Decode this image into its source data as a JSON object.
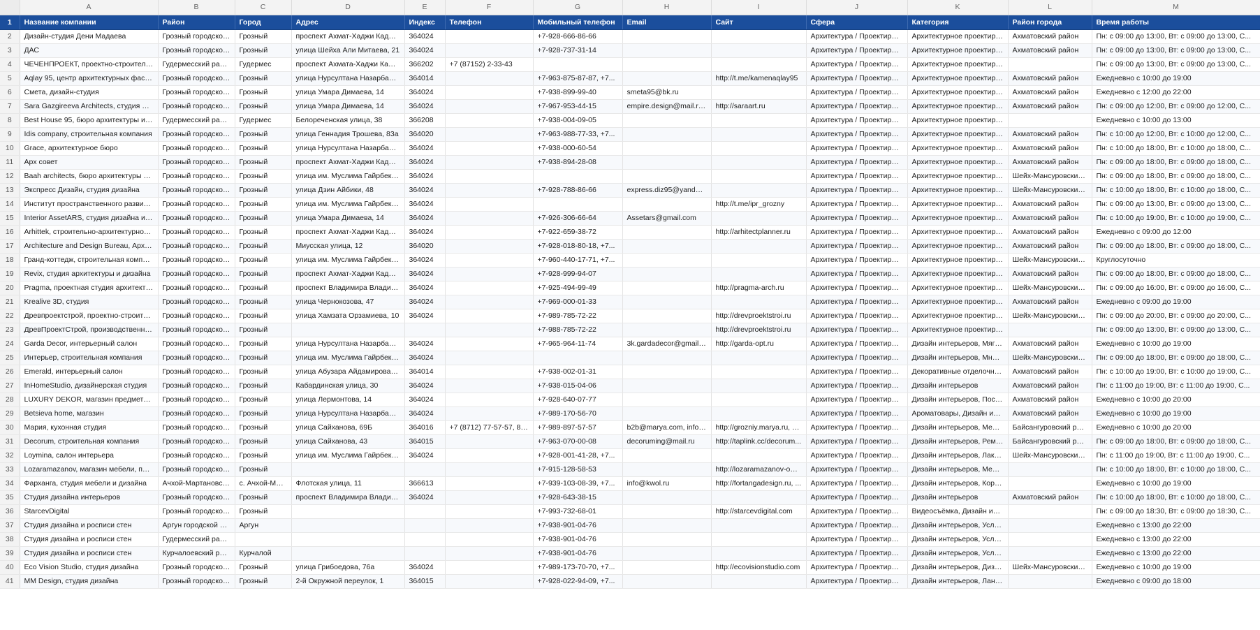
{
  "columns": [
    "A",
    "B",
    "C",
    "D",
    "E",
    "F",
    "G",
    "H",
    "I",
    "J",
    "K",
    "L",
    "M"
  ],
  "headers": [
    "Название компании",
    "Район",
    "Город",
    "Адрес",
    "Индекс",
    "Телефон",
    "Мобильный телефон",
    "Email",
    "Сайт",
    "Сфера",
    "Категория",
    "Район города",
    "Время работы"
  ],
  "rows": [
    [
      "Дизайн-студия Дени Мадаева",
      "Грозный городской ок...",
      "Грозный",
      "проспект Ахмат-Хаджи Кадыр...",
      "364024",
      "",
      "+7-928-666-86-66",
      "",
      "",
      "Архитектура / Проектиров...",
      "Архитектурное проектиро...",
      "Ахматовский район",
      "Пн: с 09:00 до 13:00, Вт: с 09:00 до 13:00, С..."
    ],
    [
      "ДАС",
      "Грозный городской ок...",
      "Грозный",
      "улица Шейха Али Митаева, 21",
      "364024",
      "",
      "+7-928-737-31-14",
      "",
      "",
      "Архитектура / Проектиров...",
      "Архитектурное проектиро...",
      "Ахматовский район",
      "Пн: с 09:00 до 13:00, Вт: с 09:00 до 13:00, С..."
    ],
    [
      "ЧЕЧЕНПРОЕКТ, проектно-строительн...",
      "Гудермесский район",
      "Гудермес",
      "проспект Ахмата-Хаджи Кады...",
      "366202",
      "+7 (87152) 2-33-43",
      "",
      "",
      "",
      "Архитектура / Проектиров...",
      "Архитектурное проектиро...",
      "",
      "Пн: с 09:00 до 13:00, Вт: с 09:00 до 13:00, С..."
    ],
    [
      "Aqlay 95, центр архитектурных фасад...",
      "Грозный городской ок...",
      "Грозный",
      "улица Нурсултана Назарбаева...",
      "364014",
      "",
      "+7-963-875-87-87, +7...",
      "",
      "http://t.me/kamenaqlay95",
      "Архитектура / Проектиров...",
      "Архитектурное проектиро...",
      "Ахматовский район",
      "Ежедневно с 10:00 до 19:00"
    ],
    [
      "Смета, дизайн-студия",
      "Грозный городской ок...",
      "Грозный",
      "улица Умара Димаева, 14",
      "364024",
      "",
      "+7-938-899-99-40",
      "smeta95@bk.ru",
      "",
      "Архитектура / Проектиров...",
      "Архитектурное проектиро...",
      "Ахматовский район",
      "Ежедневно с 12:00 до 22:00"
    ],
    [
      "Sara Gazgireeva Architects, студия арх...",
      "Грозный городской ок...",
      "Грозный",
      "улица Умара Димаева, 14",
      "364024",
      "",
      "+7-967-953-44-15",
      "empire.design@mail.ru, ...",
      "http://saraart.ru",
      "Архитектура / Проектиров...",
      "Архитектурное проектиро...",
      "Ахматовский район",
      "Пн: с 09:00 до 12:00, Вт: с 09:00 до 12:00, С..."
    ],
    [
      "Best House 95, бюро архитектуры и д...",
      "Гудермесский район",
      "Гудермес",
      "Белореченская улица, 38",
      "366208",
      "",
      "+7-938-004-09-05",
      "",
      "",
      "Архитектура / Проектиров...",
      "Архитектурное проектиро...",
      "",
      "Ежедневно с 10:00 до 13:00"
    ],
    [
      "Idis company, строительная компания",
      "Грозный городской ок...",
      "Грозный",
      "улица Геннадия Трошева, 83а",
      "364020",
      "",
      "+7-963-988-77-33, +7...",
      "",
      "",
      "Архитектура / Проектиров...",
      "Архитектурное проектиро...",
      "Ахматовский район",
      "Пн: с 10:00 до 12:00, Вт: с 10:00 до 12:00, С..."
    ],
    [
      "Grace, архитектурное бюро",
      "Грозный городской ок...",
      "Грозный",
      "улица Нурсултана Назарбаева...",
      "364024",
      "",
      "+7-938-000-60-54",
      "",
      "",
      "Архитектура / Проектиров...",
      "Архитектурное проектиро...",
      "Ахматовский район",
      "Пн: с 10:00 до 18:00, Вт: с 10:00 до 18:00, С..."
    ],
    [
      "Apx совет",
      "Грозный городской ок...",
      "Грозный",
      "проспект Ахмат-Хаджи Кадыр...",
      "364024",
      "",
      "+7-938-894-28-08",
      "",
      "",
      "Архитектура / Проектиров...",
      "Архитектурное проектиро...",
      "Ахматовский район",
      "Пн: с 09:00 до 18:00, Вт: с 09:00 до 18:00, С..."
    ],
    [
      "Baah architects, бюро архитектуры и д...",
      "Грозный городской ок...",
      "Грозный",
      "улица им. Муслима Гайрбеков...",
      "364024",
      "",
      "",
      "",
      "",
      "Архитектура / Проектиров...",
      "Архитектурное проектиро...",
      "Шейх-Мансуровский...",
      "Пн: с 09:00 до 18:00, Вт: с 09:00 до 18:00, С..."
    ],
    [
      "Экспресс Дизайн, студия дизайна",
      "Грозный городской ок...",
      "Грозный",
      "улица Дзин Айбики, 48",
      "364024",
      "",
      "+7-928-788-86-66",
      "express.diz95@yandex.ru",
      "",
      "Архитектура / Проектиров...",
      "Архитектурное проектиро...",
      "Шейх-Мансуровский...",
      "Пн: с 10:00 до 18:00, Вт: с 10:00 до 18:00, С..."
    ],
    [
      "Институт пространственного развити...",
      "Грозный городской ок...",
      "Грозный",
      "улица им. Муслима Гайрбеков...",
      "364024",
      "",
      "",
      "",
      "http://t.me/ipr_grozny",
      "Архитектура / Проектиров...",
      "Архитектурное проектиро...",
      "Ахматовский район",
      "Пн: с 09:00 до 13:00, Вт: с 09:00 до 13:00, С..."
    ],
    [
      "Interior AssetARS, студия дизайна и ин...",
      "Грозный городской ок...",
      "Грозный",
      "улица Умара Димаева, 14",
      "364024",
      "",
      "+7-926-306-66-64",
      "Assetars@gmail.com",
      "",
      "Архитектура / Проектиров...",
      "Архитектурное проектиро...",
      "Ахматовский район",
      "Пн: с 10:00 до 19:00, Вт: с 10:00 до 19:00, С..."
    ],
    [
      "Arhittek, строительно-архитектурное ...",
      "Грозный городской ок...",
      "Грозный",
      "проспект Ахмат-Хаджи Кадыр...",
      "364024",
      "",
      "+7-922-659-38-72",
      "",
      "http://arhitectplanner.ru",
      "Архитектура / Проектиров...",
      "Архитектурное проектиро...",
      "Ахматовский район",
      "Ежедневно с 09:00 до 12:00"
    ],
    [
      "Architecture and Design Bureau, Архит...",
      "Грозный городской ок...",
      "Грозный",
      "Миусская улица, 12",
      "364020",
      "",
      "+7-928-018-80-18, +7...",
      "",
      "",
      "Архитектура / Проектиров...",
      "Архитектурное проектиро...",
      "Ахматовский район",
      "Пн: с 09:00 до 18:00, Вт: с 09:00 до 18:00, С..."
    ],
    [
      "Гранд-коттедж, строительная компан...",
      "Грозный городской ок...",
      "Грозный",
      "улица им. Муслима Гайрбеков...",
      "364024",
      "",
      "+7-960-440-17-71, +7...",
      "",
      "",
      "Архитектура / Проектиров...",
      "Архитектурное проектиро...",
      "Шейх-Мансуровский...",
      "Круглосуточно"
    ],
    [
      "Revix, студия архитектуры и дизайна",
      "Грозный городской ок...",
      "Грозный",
      "проспект Ахмат-Хаджи Кадыр...",
      "364024",
      "",
      "+7-928-999-94-07",
      "",
      "",
      "Архитектура / Проектиров...",
      "Архитектурное проектиро...",
      "Ахматовский район",
      "Пн: с 09:00 до 18:00, Вт: с 09:00 до 18:00, С..."
    ],
    [
      "Pragma, проектная студия архитектур...",
      "Грозный городской ок...",
      "Грозный",
      "проспект Владимира Владими...",
      "364024",
      "",
      "+7-925-494-99-49",
      "",
      "http://pragma-arch.ru",
      "Архитектура / Проектиров...",
      "Архитектурное проектиро...",
      "Шейх-Мансуровский...",
      "Пн: с 09:00 до 16:00, Вт: с 09:00 до 16:00, С..."
    ],
    [
      "Krealive 3D, студия",
      "Грозный городской ок...",
      "Грозный",
      "улица Чернокозова, 47",
      "364024",
      "",
      "+7-969-000-01-33",
      "",
      "",
      "Архитектура / Проектиров...",
      "Архитектурное проектиро...",
      "Ахматовский район",
      "Ежедневно с 09:00 до 19:00"
    ],
    [
      "Древпроектстрой, проектно-строител...",
      "Грозный городской ок...",
      "Грозный",
      "улица Хамзата Орзамиева, 10",
      "364024",
      "",
      "+7-989-785-72-22",
      "",
      "http://drevproektstroi.ru",
      "Архитектура / Проектиров...",
      "Архитектурное проектиро...",
      "Шейх-Мансуровский...",
      "Пн: с 09:00 до 20:00, Вт: с 09:00 до 20:00, С..."
    ],
    [
      "ДревПроектСтрой, производственно-...",
      "Грозный городской ок...",
      "Грозный",
      "",
      "",
      "",
      "+7-988-785-72-22",
      "",
      "http://drevproektstroi.ru",
      "Архитектура / Проектиров...",
      "Архитектурное проектиро...",
      "",
      "Пн: с 09:00 до 13:00, Вт: с 09:00 до 13:00, С..."
    ],
    [
      "Garda Decor, интерьерный салон",
      "Грозный городской ок...",
      "Грозный",
      "улица Нурсултана Назарбаева...",
      "364024",
      "",
      "+7-965-964-11-74",
      "3k.gardadecor@gmail.c...",
      "http://garda-opt.ru",
      "Архитектура / Проектиров...",
      "Дизайн интерьеров, Мягка...",
      "Ахматовский район",
      "Ежедневно с 10:00 до 19:00"
    ],
    [
      "Интерьер, строительная компания",
      "Грозный городской ок...",
      "Грозный",
      "улица им. Муслима Гайрбеков...",
      "364024",
      "",
      "",
      "",
      "",
      "Архитектура / Проектиров...",
      "Дизайн интерьеров, Мног...",
      "Шейх-Мансуровский...",
      "Пн: с 09:00 до 18:00, Вт: с 09:00 до 18:00, С..."
    ],
    [
      "Emerald, интерьерный салон",
      "Грозный городской ок...",
      "Грозный",
      "улица Абузара Айдамирова, 1...",
      "364014",
      "",
      "+7-938-002-01-31",
      "",
      "",
      "Архитектура / Проектиров...",
      "Декоративные отделочны...",
      "Ахматовский район",
      "Пн: с 10:00 до 19:00, Вт: с 10:00 до 19:00, С..."
    ],
    [
      "InHomeStudio, дизайнерская студия",
      "Грозный городской ок...",
      "Грозный",
      "Кабардинская улица, 30",
      "364024",
      "",
      "+7-938-015-04-06",
      "",
      "",
      "Архитектура / Проектиров...",
      "Дизайн интерьеров",
      "Ахматовский район",
      "Пн: с 11:00 до 19:00, Вт: с 11:00 до 19:00, С..."
    ],
    [
      "LUXURY DEKOR, магазин предметов и...",
      "Грозный городской ок...",
      "Грозный",
      "улица Лермонтова, 14",
      "364024",
      "",
      "+7-928-640-07-77",
      "",
      "",
      "Архитектура / Проектиров...",
      "Дизайн интерьеров, Посуд...",
      "Ахматовский район",
      "Ежедневно с 10:00 до 20:00"
    ],
    [
      "Betsieva home, магазин",
      "Грозный городской ок...",
      "Грозный",
      "улица Нурсултана Назарбаева...",
      "364024",
      "",
      "+7-989-170-56-70",
      "",
      "",
      "Архитектура / Проектиров...",
      "Ароматовары, Дизайн инт...",
      "Ахматовский район",
      "Ежедневно с 10:00 до 19:00"
    ],
    [
      "Мария, кухонная студия",
      "Грозный городской ок...",
      "Грозный",
      "улица Сайханова, 69Б",
      "364016",
      "+7 (8712) 77-57-57, 8-...",
      "+7-989-897-57-57",
      "b2b@marya.com, info@...",
      "http://grozniy.marya.ru, ht...",
      "Архитектура / Проектиров...",
      "Дизайн интерьеров, Мебе...",
      "Байсангуровский рай...",
      "Ежедневно с 10:00 до 20:00"
    ],
    [
      "Decorum, строительная компания",
      "Грозный городской ок...",
      "Грозный",
      "улица Сайханова, 43",
      "364015",
      "",
      "+7-963-070-00-08",
      "decoruming@mail.ru",
      "http://taplink.cc/decorum...",
      "Архитектура / Проектиров...",
      "Дизайн интерьеров, Ремо...",
      "Байсангуровский рай...",
      "Пн: с 09:00 до 18:00, Вт: с 09:00 до 18:00, С..."
    ],
    [
      "Loymina, салон интерьера",
      "Грозный городской ок...",
      "Грозный",
      "улица им. Муслима Гайрбеков...",
      "364024",
      "",
      "+7-928-001-41-28, +7...",
      "",
      "",
      "Архитектура / Проектиров...",
      "Дизайн интерьеров, Лаки ...",
      "Шейх-Мансуровский...",
      "Пн: с 11:00 до 19:00, Вт: с 11:00 до 19:00, С..."
    ],
    [
      "Lozaramazanov, магазин мебели, плет...",
      "Грозный городской ок...",
      "Грозный",
      "",
      "",
      "",
      "+7-915-128-58-53",
      "",
      "http://lozaramazanov-onli...",
      "Архитектура / Проектиров...",
      "Дизайн интерьеров, Мебе...",
      "",
      "Пн: с 10:00 до 18:00, Вт: с 10:00 до 18:00, С..."
    ],
    [
      "Фарханга, студия мебели и дизайна",
      "Ачхой-Мартановский ...",
      "с. Ачхой-Мартан",
      "Флотская улица, 11",
      "366613",
      "",
      "+7-939-103-08-39, +7...",
      "info@kwol.ru",
      "http://fortangadesign.ru, ...",
      "Архитектура / Проектиров...",
      "Дизайн интерьеров, Корп...",
      "",
      "Ежедневно с 10:00 до 19:00"
    ],
    [
      "Студия дизайна интерьеров",
      "Грозный городской ок...",
      "Грозный",
      "проспект Владимира Владими...",
      "364024",
      "",
      "+7-928-643-38-15",
      "",
      "",
      "Архитектура / Проектиров...",
      "Дизайн интерьеров",
      "Ахматовский район",
      "Пн: с 10:00 до 18:00, Вт: с 10:00 до 18:00, С..."
    ],
    [
      "StarcevDigital",
      "Грозный городской ок...",
      "Грозный",
      "",
      "",
      "",
      "+7-993-732-68-01",
      "",
      "http://starcevdigital.com",
      "Архитектура / Проектиров...",
      "Видеосъёмка, Дизайн инте...",
      "",
      "Пн: с 09:00 до 18:30, Вт: с 09:00 до 18:30, С..."
    ],
    [
      "Студия дизайна и росписи стен",
      "Аргун городской округ",
      "Аргун",
      "",
      "",
      "",
      "+7-938-901-04-76",
      "",
      "",
      "Архитектура / Проектиров...",
      "Дизайн интерьеров, Услуг...",
      "",
      "Ежедневно с 13:00 до 22:00"
    ],
    [
      "Студия дизайна и росписи стен",
      "Гудермесский район",
      "",
      "",
      "",
      "",
      "+7-938-901-04-76",
      "",
      "",
      "Архитектура / Проектиров...",
      "Дизайн интерьеров, Услуг...",
      "",
      "Ежедневно с 13:00 до 22:00"
    ],
    [
      "Студия дизайна и росписи стен",
      "Курчалоевский район",
      "Курчалой",
      "",
      "",
      "",
      "+7-938-901-04-76",
      "",
      "",
      "Архитектура / Проектиров...",
      "Дизайн интерьеров, Услуг...",
      "",
      "Ежедневно с 13:00 до 22:00"
    ],
    [
      "Eco Vision Studio, студия дизайна",
      "Грозный городской ок...",
      "Грозный",
      "улица Грибоедова, 76а",
      "364024",
      "",
      "+7-989-173-70-70, +7...",
      "",
      "http://ecovisionstudio.com",
      "Архитектура / Проектиров...",
      "Дизайн интерьеров, Дизай...",
      "Шейх-Мансуровский...",
      "Ежедневно с 10:00 до 19:00"
    ],
    [
      "MM Design, студия дизайна",
      "Грозный городской ок...",
      "Грозный",
      "2-й Окружной переулок, 1",
      "364015",
      "",
      "+7-928-022-94-09, +7...",
      "",
      "",
      "Архитектура / Проектиров...",
      "Дизайн интерьеров, Ланд...",
      "",
      "Ежедневно с 09:00 до 18:00"
    ]
  ]
}
